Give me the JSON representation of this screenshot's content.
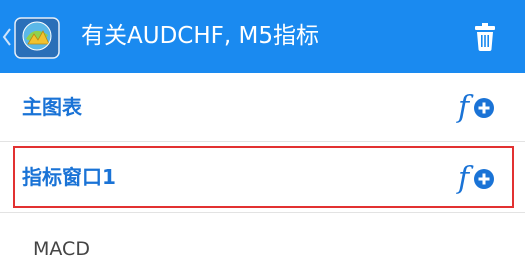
{
  "header": {
    "title": "有关AUDCHF, M5指标",
    "background_color": "#1a8af0",
    "back_icon": "chevron-left-icon",
    "logo_icon": "metatrader-logo-icon",
    "action_icon": "trash-icon"
  },
  "sections": {
    "main_chart": {
      "label": "主图表",
      "action_icon": "add-function-icon"
    },
    "indicator_window": {
      "label": "指标窗口1",
      "action_icon": "add-function-icon",
      "highlighted": true
    }
  },
  "indicators": [
    {
      "label": "MACD"
    }
  ],
  "colors": {
    "accent_blue": "#1a73d6",
    "highlight_red": "#e23131"
  }
}
